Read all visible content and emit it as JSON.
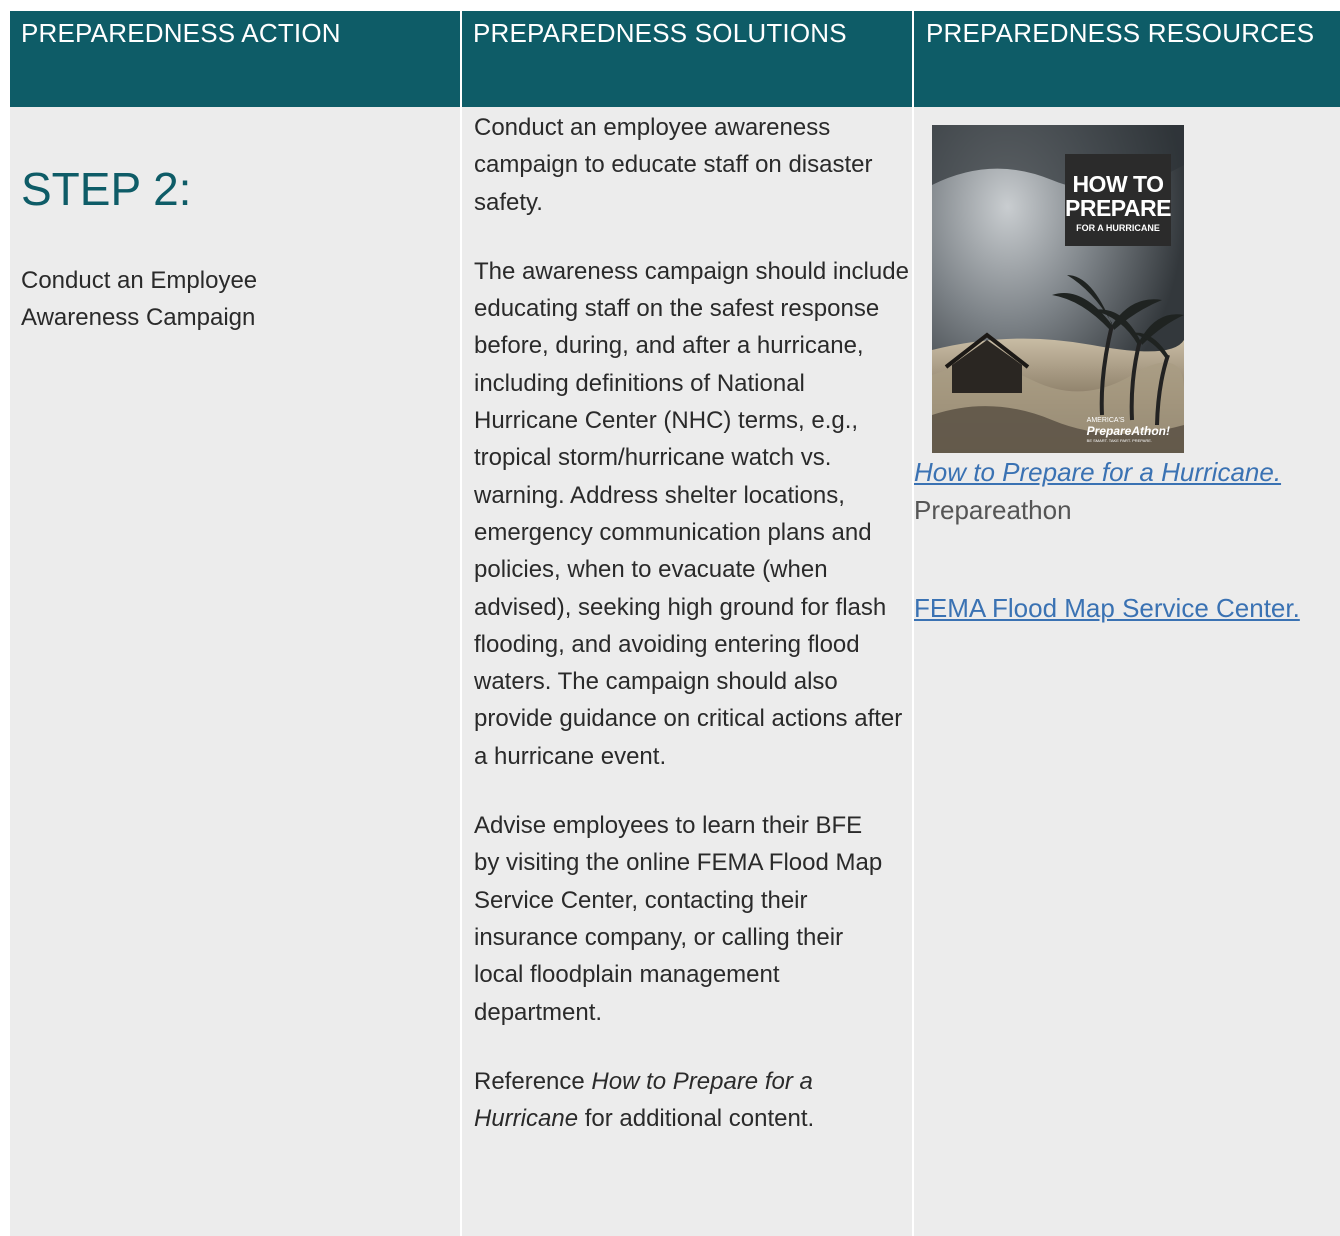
{
  "headers": {
    "action": "PREPAREDNESS ACTION",
    "solutions": "PREPAREDNESS SOLUTIONS",
    "resources": "PREPAREDNESS RESOURCES"
  },
  "action": {
    "step": "STEP 2:",
    "description": "Conduct an Employee Awareness Campaign"
  },
  "solutions": {
    "p1": "Conduct an employee awareness campaign to educate staff on disaster safety.",
    "p2": "The awareness campaign should include educating staff on the safest response before, during, and after a hurricane, including definitions of National Hurricane Center (NHC) terms, e.g., tropical storm/hurricane watch vs. warning. Address shelter locations, emergency communication plans and policies, when to evacuate (when advised), seeking high ground for flash flooding, and avoiding entering flood waters. The campaign should also provide guidance on critical actions after a hurricane event.",
    "p3": "Advise employees to learn their BFE by visiting the online FEMA Flood Map Service Center, contacting their insurance company, or calling their local floodplain management department.",
    "p4_prefix": "Reference ",
    "p4_title": "How to Prepare for a Hurricane",
    "p4_suffix": " for additional content."
  },
  "resources": {
    "cover": {
      "title_main": "HOW TO PREPARE",
      "title_sub": "FOR A HURRICANE",
      "brand_top": "AMERICA'S",
      "brand_main": "PrepareAthon!",
      "brand_tag": "BE SMART. TAKE PART. PREPARE."
    },
    "link1": "How to Prepare for a Hurricane.",
    "source1": "Prepareathon",
    "link2": "FEMA Flood Map Service Center."
  }
}
